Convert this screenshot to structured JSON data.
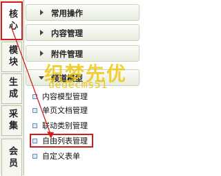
{
  "side_tabs": [
    {
      "label": "核心",
      "active": true
    },
    {
      "label": "模块",
      "active": false
    },
    {
      "label": "生成",
      "active": false
    },
    {
      "label": "采集",
      "active": false
    },
    {
      "label": "会员",
      "active": false
    }
  ],
  "menu_groups": [
    {
      "label": "常用操作",
      "expanded": false
    },
    {
      "label": "内容管理",
      "expanded": false
    },
    {
      "label": "附件管理",
      "expanded": false
    },
    {
      "label": "频道模型",
      "expanded": true
    }
  ],
  "channel_model_items": [
    {
      "label": "内容模型管理",
      "selected": false
    },
    {
      "label": "单页文档管理",
      "selected": false
    },
    {
      "label": "联动类别管理",
      "selected": false
    },
    {
      "label": "自由列表管理",
      "selected": true
    },
    {
      "label": "自定义表单",
      "selected": false
    }
  ],
  "watermark": {
    "main": "织梦先优",
    "sub": "dedecms51"
  },
  "colors": {
    "highlight": "#d41b1b",
    "watermark": "#eec400"
  }
}
